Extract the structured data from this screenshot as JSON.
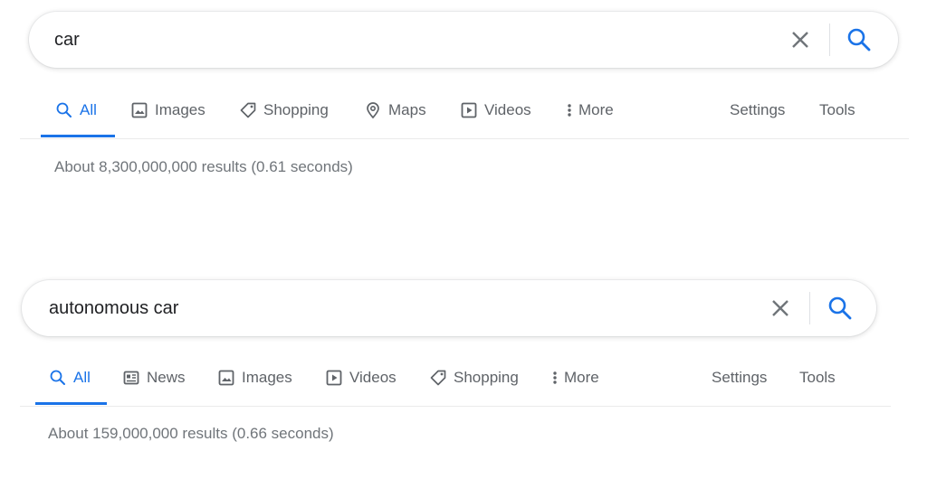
{
  "colors": {
    "accent": "#1a73e8",
    "text_muted": "#5f6368",
    "stats_text": "#70757a",
    "query_text": "#202124"
  },
  "searches": [
    {
      "query": "car",
      "tabs": [
        {
          "label": "All",
          "icon": "search-icon",
          "active": true
        },
        {
          "label": "Images",
          "icon": "image-icon"
        },
        {
          "label": "Shopping",
          "icon": "tag-icon"
        },
        {
          "label": "Maps",
          "icon": "map-pin-icon"
        },
        {
          "label": "Videos",
          "icon": "play-icon"
        },
        {
          "label": "More",
          "icon": "more-vert-icon"
        }
      ],
      "settings_label": "Settings",
      "tools_label": "Tools",
      "result_stats": "About 8,300,000,000 results (0.61 seconds)"
    },
    {
      "query": "autonomous car",
      "tabs": [
        {
          "label": "All",
          "icon": "search-icon",
          "active": true
        },
        {
          "label": "News",
          "icon": "news-icon"
        },
        {
          "label": "Images",
          "icon": "image-icon"
        },
        {
          "label": "Videos",
          "icon": "play-icon"
        },
        {
          "label": "Shopping",
          "icon": "tag-icon"
        },
        {
          "label": "More",
          "icon": "more-vert-icon"
        }
      ],
      "settings_label": "Settings",
      "tools_label": "Tools",
      "result_stats": "About 159,000,000 results (0.66 seconds)"
    }
  ]
}
